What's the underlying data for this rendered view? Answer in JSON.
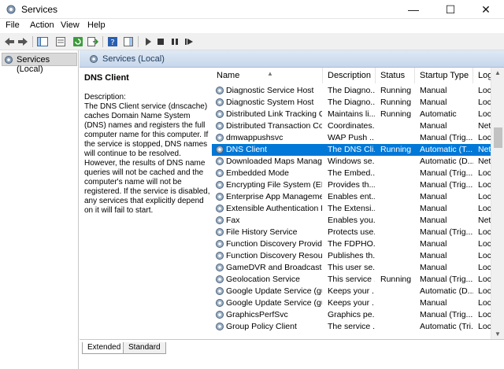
{
  "window": {
    "title": "Services"
  },
  "menu": [
    "File",
    "Action",
    "View",
    "Help"
  ],
  "toolbar_icons": [
    "back-icon",
    "forward-icon",
    "up-icon",
    "show-hide-icon",
    "refresh-icon",
    "export-icon",
    "help-icon",
    "properties-icon",
    "start-icon",
    "stop-icon",
    "pause-icon",
    "restart-icon"
  ],
  "tree": {
    "item": "Services (Local)"
  },
  "panel": {
    "header": "Services (Local)",
    "selected_name": "DNS Client",
    "description_label": "Description:",
    "description": "The DNS Client service (dnscache) caches Domain Name System (DNS) names and registers the full computer name for this computer. If the service is stopped, DNS names will continue to be resolved. However, the results of DNS name queries will not be cached and the computer's name will not be registered. If the service is disabled, any services that explicitly depend on it will fail to start."
  },
  "columns": [
    "Name",
    "Description",
    "Status",
    "Startup Type",
    "Log"
  ],
  "rows": [
    {
      "name": "Diagnostic Service Host",
      "desc": "The Diagno...",
      "status": "Running",
      "startup": "Manual",
      "log": "Loc"
    },
    {
      "name": "Diagnostic System Host",
      "desc": "The Diagno...",
      "status": "Running",
      "startup": "Manual",
      "log": "Loc"
    },
    {
      "name": "Distributed Link Tracking Cl...",
      "desc": "Maintains li...",
      "status": "Running",
      "startup": "Automatic",
      "log": "Loc"
    },
    {
      "name": "Distributed Transaction Coo...",
      "desc": "Coordinates...",
      "status": "",
      "startup": "Manual",
      "log": "Net"
    },
    {
      "name": "dmwappushsvc",
      "desc": "WAP Push ...",
      "status": "",
      "startup": "Manual (Trig...",
      "log": "Loc"
    },
    {
      "name": "DNS Client",
      "desc": "The DNS Cli...",
      "status": "Running",
      "startup": "Automatic (T...",
      "log": "Net"
    },
    {
      "name": "Downloaded Maps Manager",
      "desc": "Windows se...",
      "status": "",
      "startup": "Automatic (D...",
      "log": "Net"
    },
    {
      "name": "Embedded Mode",
      "desc": "The Embed...",
      "status": "",
      "startup": "Manual (Trig...",
      "log": "Loc"
    },
    {
      "name": "Encrypting File System (EFS)",
      "desc": "Provides th...",
      "status": "",
      "startup": "Manual (Trig...",
      "log": "Loc"
    },
    {
      "name": "Enterprise App Managemen...",
      "desc": "Enables ent...",
      "status": "",
      "startup": "Manual",
      "log": "Loc"
    },
    {
      "name": "Extensible Authentication P...",
      "desc": "The Extensi...",
      "status": "",
      "startup": "Manual",
      "log": "Loc"
    },
    {
      "name": "Fax",
      "desc": "Enables you...",
      "status": "",
      "startup": "Manual",
      "log": "Net"
    },
    {
      "name": "File History Service",
      "desc": "Protects use...",
      "status": "",
      "startup": "Manual (Trig...",
      "log": "Loc"
    },
    {
      "name": "Function Discovery Provide...",
      "desc": "The FDPHO...",
      "status": "",
      "startup": "Manual",
      "log": "Loc"
    },
    {
      "name": "Function Discovery Resourc...",
      "desc": "Publishes th...",
      "status": "",
      "startup": "Manual",
      "log": "Loc"
    },
    {
      "name": "GameDVR and Broadcast Us...",
      "desc": "This user se...",
      "status": "",
      "startup": "Manual",
      "log": "Loc"
    },
    {
      "name": "Geolocation Service",
      "desc": "This service ...",
      "status": "Running",
      "startup": "Manual (Trig...",
      "log": "Loc"
    },
    {
      "name": "Google Update Service (gup...",
      "desc": "Keeps your ...",
      "status": "",
      "startup": "Automatic (D...",
      "log": "Loc"
    },
    {
      "name": "Google Update Service (gup...",
      "desc": "Keeps your ...",
      "status": "",
      "startup": "Manual",
      "log": "Loc"
    },
    {
      "name": "GraphicsPerfSvc",
      "desc": "Graphics pe...",
      "status": "",
      "startup": "Manual (Trig...",
      "log": "Loc"
    },
    {
      "name": "Group Policy Client",
      "desc": "The service ...",
      "status": "",
      "startup": "Automatic (Tri...",
      "log": "Loc"
    }
  ],
  "selected_index": 5,
  "tabs": [
    "Extended",
    "Standard"
  ],
  "colors": {
    "selection": "#0078d7",
    "header_gradient_top": "#dfe9f5",
    "header_text": "#1e395b"
  }
}
